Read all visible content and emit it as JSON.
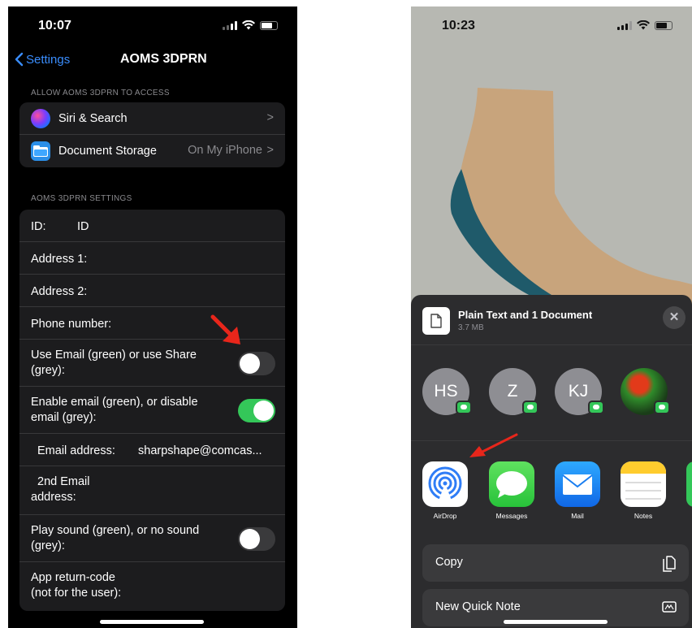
{
  "left": {
    "status": {
      "time": "10:07"
    },
    "nav": {
      "back": "Settings",
      "title": "AOMS 3DPRN"
    },
    "access_header": "ALLOW AOMS 3DPRN TO ACCESS",
    "access_items": [
      {
        "label": "Siri & Search",
        "value": ""
      },
      {
        "label": "Document Storage",
        "value": "On My iPhone"
      }
    ],
    "settings_header": "AOMS 3DPRN SETTINGS",
    "settings": {
      "id_label": "ID:",
      "id_value": "ID",
      "address1": "Address 1:",
      "address2": "Address 2:",
      "phone": "Phone number:",
      "use_email_line1": "Use Email (green) or use Share",
      "use_email_line2": "(grey):",
      "use_email_on": false,
      "enable_email_line1": "Enable email (green), or disable",
      "enable_email_line2": "email (grey):",
      "enable_email_on": true,
      "email_label": "Email address:",
      "email_value": "sharpshape@comcas...",
      "email2_line1": "2nd Email",
      "email2_line2": "address:",
      "sound_line1": "Play sound (green), or no sound",
      "sound_line2": "(grey):",
      "sound_on": false,
      "return_line1": "App return-code",
      "return_line2": "(not for the user):"
    }
  },
  "right": {
    "status": {
      "time": "10:23"
    },
    "share_sheet": {
      "title": "Plain Text and 1 Document",
      "subtitle": "3.7 MB",
      "close_glyph": "✕",
      "contacts": [
        {
          "initials": "HS"
        },
        {
          "initials": "Z"
        },
        {
          "initials": "KJ"
        },
        {
          "initials": ""
        }
      ],
      "apps": [
        {
          "name": "AirDrop"
        },
        {
          "name": "Messages"
        },
        {
          "name": "Mail"
        },
        {
          "name": "Notes"
        }
      ],
      "actions": [
        {
          "label": "Copy",
          "icon": "copy-icon"
        },
        {
          "label": "New Quick Note",
          "icon": "quick-note-icon"
        }
      ]
    }
  },
  "colors": {
    "accent_blue": "#3a8dfd",
    "toggle_on": "#34c759",
    "toggle_off": "#3a3a3c",
    "annotation_arrow": "#e8261b",
    "sock": "#c8a47c",
    "insole": "#1f5a6a"
  }
}
